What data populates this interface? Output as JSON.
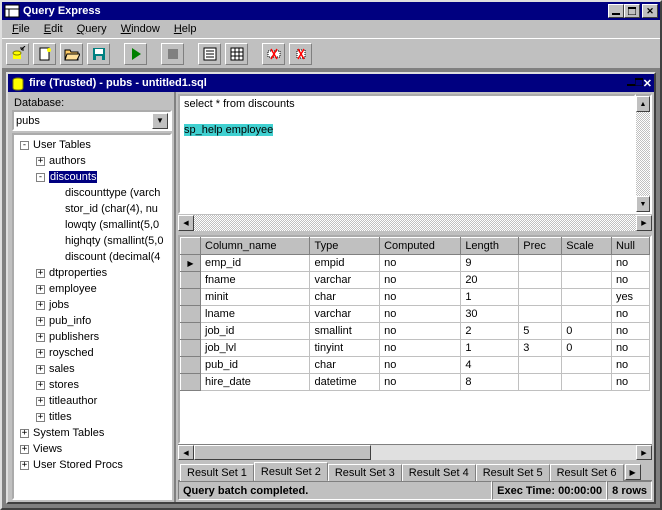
{
  "window": {
    "title": "Query Express"
  },
  "menu": {
    "file": "File",
    "edit": "Edit",
    "query": "Query",
    "window": "Window",
    "help": "Help"
  },
  "child": {
    "title": "fire (Trusted) - pubs - untitled1.sql"
  },
  "left": {
    "label": "Database:",
    "database": "pubs",
    "tree": [
      {
        "level": 0,
        "exp": "-",
        "label": "User Tables"
      },
      {
        "level": 1,
        "exp": "+",
        "label": "authors"
      },
      {
        "level": 1,
        "exp": "-",
        "label": "discounts",
        "selected": true
      },
      {
        "level": 2,
        "exp": "",
        "label": "discounttype (varch"
      },
      {
        "level": 2,
        "exp": "",
        "label": "stor_id (char(4), nu"
      },
      {
        "level": 2,
        "exp": "",
        "label": "lowqty (smallint(5,0"
      },
      {
        "level": 2,
        "exp": "",
        "label": "highqty (smallint(5,0"
      },
      {
        "level": 2,
        "exp": "",
        "label": "discount (decimal(4"
      },
      {
        "level": 1,
        "exp": "+",
        "label": "dtproperties"
      },
      {
        "level": 1,
        "exp": "+",
        "label": "employee"
      },
      {
        "level": 1,
        "exp": "+",
        "label": "jobs"
      },
      {
        "level": 1,
        "exp": "+",
        "label": "pub_info"
      },
      {
        "level": 1,
        "exp": "+",
        "label": "publishers"
      },
      {
        "level": 1,
        "exp": "+",
        "label": "roysched"
      },
      {
        "level": 1,
        "exp": "+",
        "label": "sales"
      },
      {
        "level": 1,
        "exp": "+",
        "label": "stores"
      },
      {
        "level": 1,
        "exp": "+",
        "label": "titleauthor"
      },
      {
        "level": 1,
        "exp": "+",
        "label": "titles"
      },
      {
        "level": 0,
        "exp": "+",
        "label": "System Tables"
      },
      {
        "level": 0,
        "exp": "+",
        "label": "Views"
      },
      {
        "level": 0,
        "exp": "+",
        "label": "User Stored Procs"
      }
    ]
  },
  "editor": {
    "line1": "select * from discounts",
    "line2": "sp_help employee"
  },
  "grid": {
    "headers": [
      "Column_name",
      "Type",
      "Computed",
      "Length",
      "Prec",
      "Scale",
      "Null"
    ],
    "rows": [
      [
        "emp_id",
        "empid",
        "no",
        "9",
        "",
        "",
        "no"
      ],
      [
        "fname",
        "varchar",
        "no",
        "20",
        "",
        "",
        "no"
      ],
      [
        "minit",
        "char",
        "no",
        "1",
        "",
        "",
        "yes"
      ],
      [
        "lname",
        "varchar",
        "no",
        "30",
        "",
        "",
        "no"
      ],
      [
        "job_id",
        "smallint",
        "no",
        "2",
        "5",
        "0",
        "no"
      ],
      [
        "job_lvl",
        "tinyint",
        "no",
        "1",
        "3",
        "0",
        "no"
      ],
      [
        "pub_id",
        "char",
        "no",
        "4",
        "",
        "",
        "no"
      ],
      [
        "hire_date",
        "datetime",
        "no",
        "8",
        "",
        "",
        "no"
      ]
    ]
  },
  "tabs": [
    "Result Set 1",
    "Result Set 2",
    "Result Set 3",
    "Result Set 4",
    "Result Set 5",
    "Result Set 6"
  ],
  "active_tab": 1,
  "status": {
    "msg": "Query batch completed.",
    "time": "Exec Time: 00:00:00",
    "rows": "8 rows"
  },
  "chart_data": {
    "type": "table",
    "title": "sp_help employee — Result Set 2",
    "columns": [
      "Column_name",
      "Type",
      "Computed",
      "Length",
      "Prec",
      "Scale",
      "Null"
    ],
    "rows": [
      [
        "emp_id",
        "empid",
        "no",
        9,
        null,
        null,
        "no"
      ],
      [
        "fname",
        "varchar",
        "no",
        20,
        null,
        null,
        "no"
      ],
      [
        "minit",
        "char",
        "no",
        1,
        null,
        null,
        "yes"
      ],
      [
        "lname",
        "varchar",
        "no",
        30,
        null,
        null,
        "no"
      ],
      [
        "job_id",
        "smallint",
        "no",
        2,
        5,
        0,
        "no"
      ],
      [
        "job_lvl",
        "tinyint",
        "no",
        1,
        3,
        0,
        "no"
      ],
      [
        "pub_id",
        "char",
        "no",
        4,
        null,
        null,
        "no"
      ],
      [
        "hire_date",
        "datetime",
        "no",
        8,
        null,
        null,
        "no"
      ]
    ]
  }
}
